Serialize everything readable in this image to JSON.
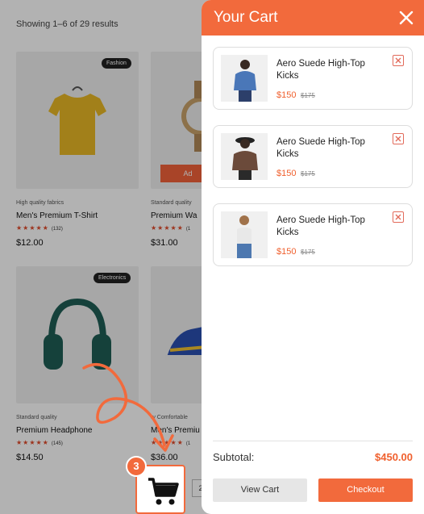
{
  "shop": {
    "results_text": "Showing 1–6 of 29 results",
    "products": [
      {
        "badge": "Fashion",
        "meta": "High quality fabrics",
        "name": "Men's Premium T-Shirt",
        "stars": "★★★★★",
        "count": "(132)",
        "price": "$12.00"
      },
      {
        "badge": "",
        "meta": "Standard quality",
        "name": "Premium Wa",
        "stars": "★★★★★",
        "count": "(1",
        "price": "$31.00",
        "add_label": "Ad"
      },
      {
        "badge": "Electronics",
        "meta": "Standard quality",
        "name": "Premium Headphone",
        "stars": "★★★★★",
        "count": "(145)",
        "price": "$14.50"
      },
      {
        "badge": "",
        "meta": "ry Comfortable",
        "name": "Men's Premiu",
        "stars": "★★★★★",
        "count": "(1",
        "price": "$36.00"
      }
    ],
    "pager_label": "2"
  },
  "cart": {
    "title": "Your Cart",
    "items": [
      {
        "name": "Aero Suede High-Top Kicks",
        "price": "$150",
        "old_price": "$175"
      },
      {
        "name": "Aero Suede High-Top Kicks",
        "price": "$150",
        "old_price": "$175"
      },
      {
        "name": "Aero Suede High-Top Kicks",
        "price": "$150",
        "old_price": "$175"
      }
    ],
    "subtotal_label": "Subtotal:",
    "subtotal_value": "$450.00",
    "view_cart_label": "View Cart",
    "checkout_label": "Checkout"
  },
  "floating_cart": {
    "count": "3",
    "icon": "shopping-cart-icon"
  },
  "colors": {
    "accent": "#f26a3c",
    "price": "#f0602e"
  }
}
